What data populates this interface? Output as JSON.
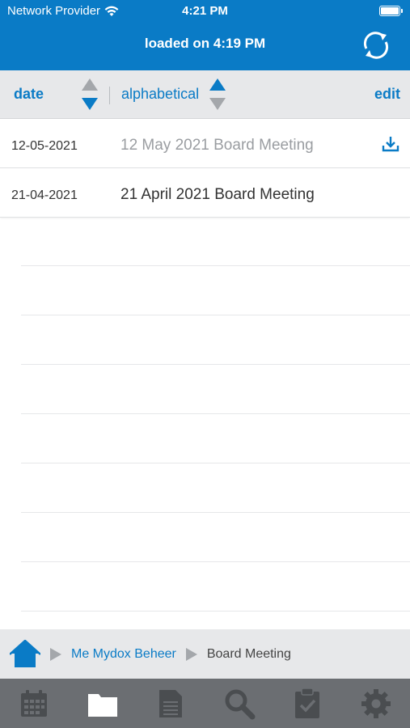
{
  "status": {
    "carrier": "Network Provider",
    "time": "4:21 PM"
  },
  "header": {
    "title": "loaded on 4:19 PM"
  },
  "sort": {
    "date_label": "date",
    "alpha_label": "alphabetical",
    "edit_label": "edit"
  },
  "meetings": [
    {
      "date": "12-05-2021",
      "title": "12 May 2021 Board Meeting",
      "downloaded": false
    },
    {
      "date": "21-04-2021",
      "title": "21 April 2021 Board Meeting",
      "downloaded": true
    }
  ],
  "breadcrumb": {
    "parent": "Me Mydox Beheer",
    "current": "Board Meeting"
  },
  "tabs": [
    "calendar-icon",
    "folder-icon",
    "document-icon",
    "search-icon",
    "clipboard-check-icon",
    "gear-icon"
  ],
  "colors": {
    "accent": "#0a7bc6",
    "tabbar": "#6b6e72",
    "tab_active": "#ffffff",
    "tab_inactive": "#4a4d50"
  }
}
